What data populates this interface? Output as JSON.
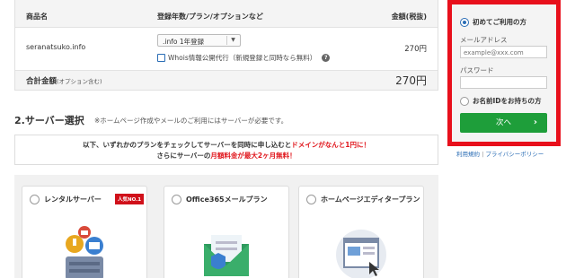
{
  "order_table": {
    "headers": {
      "product": "商品名",
      "plan": "登録年数/プラン/オプションなど",
      "amount": "金額(税抜)"
    },
    "domain": "seranatsuko.info",
    "plan_select": ".info 1年登録",
    "whois_option": "Whois情報公開代行（新規登録と同時なら無料）",
    "price": "270円",
    "total_label": "合計金額",
    "total_sub": "(オプション含む)",
    "total_value": "270円"
  },
  "server_section": {
    "title": "2.サーバー選択",
    "note": "※ホームページ作成やメールのご利用にはサーバーが必要です。",
    "notice_line1_a": "以下、いずれかのプランをチェックしてサーバーを同時に申し込むと",
    "notice_line1_b": "ドメインがなんと1円に！",
    "notice_line2_a": "さらにサーバーの",
    "notice_line2_b": "月額料金が最大2ヶ月無料！",
    "plans": [
      {
        "label": "レンタルサーバー",
        "badge": "人気NO.1"
      },
      {
        "label": "Office365メールプラン"
      },
      {
        "label": "ホームページエディタープラン"
      }
    ]
  },
  "login": {
    "first_time": "初めてご利用の方",
    "email_label": "メールアドレス",
    "email_placeholder": "example@xxx.com",
    "password_label": "パスワード",
    "has_id": "お名前IDをお持ちの方",
    "next_button": "次へ",
    "terms": "利用規約",
    "separator": "|",
    "privacy": "プライバシーポリシー"
  },
  "colors": {
    "accent_red": "#e8101c",
    "next_green": "#1e9e3a",
    "link_blue": "#2a6db5"
  }
}
